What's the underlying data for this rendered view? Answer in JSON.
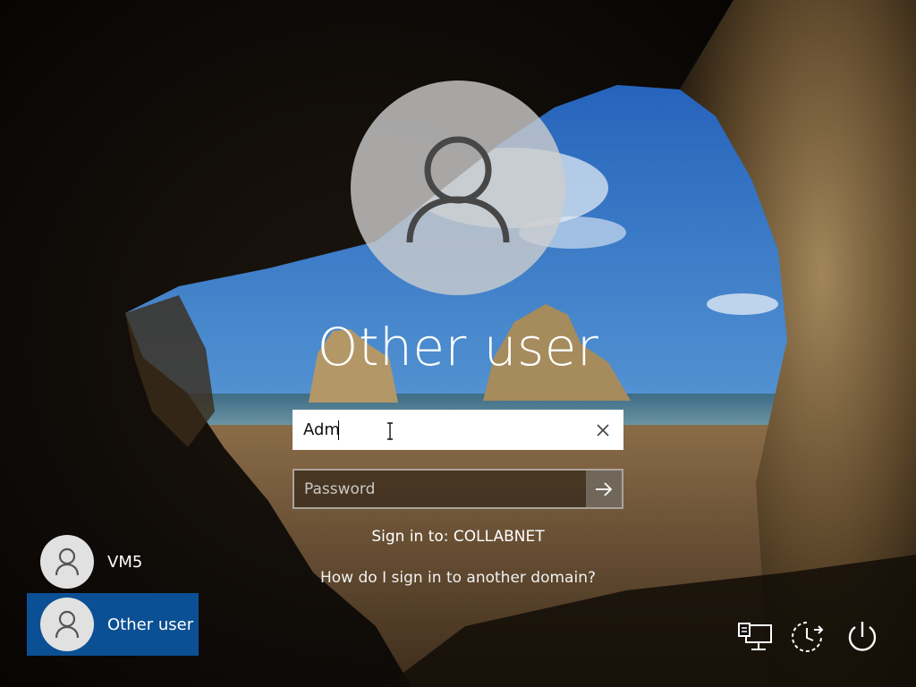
{
  "login": {
    "title": "Other user",
    "username_value": "Adm",
    "password_placeholder": "Password",
    "sign_in_to": "Sign in to: COLLABNET",
    "domain_link": "How do I sign in to another domain?"
  },
  "users": [
    {
      "name": "VM5",
      "selected": false
    },
    {
      "name": "Other user",
      "selected": true
    }
  ],
  "system_buttons": {
    "network": "network-icon",
    "ease_of_access": "ease-of-access-icon",
    "power": "power-icon"
  },
  "colors": {
    "selected_tile": "#0b5094",
    "avatar_circle": "#cdcdcd",
    "input_background": "#ffffff"
  }
}
